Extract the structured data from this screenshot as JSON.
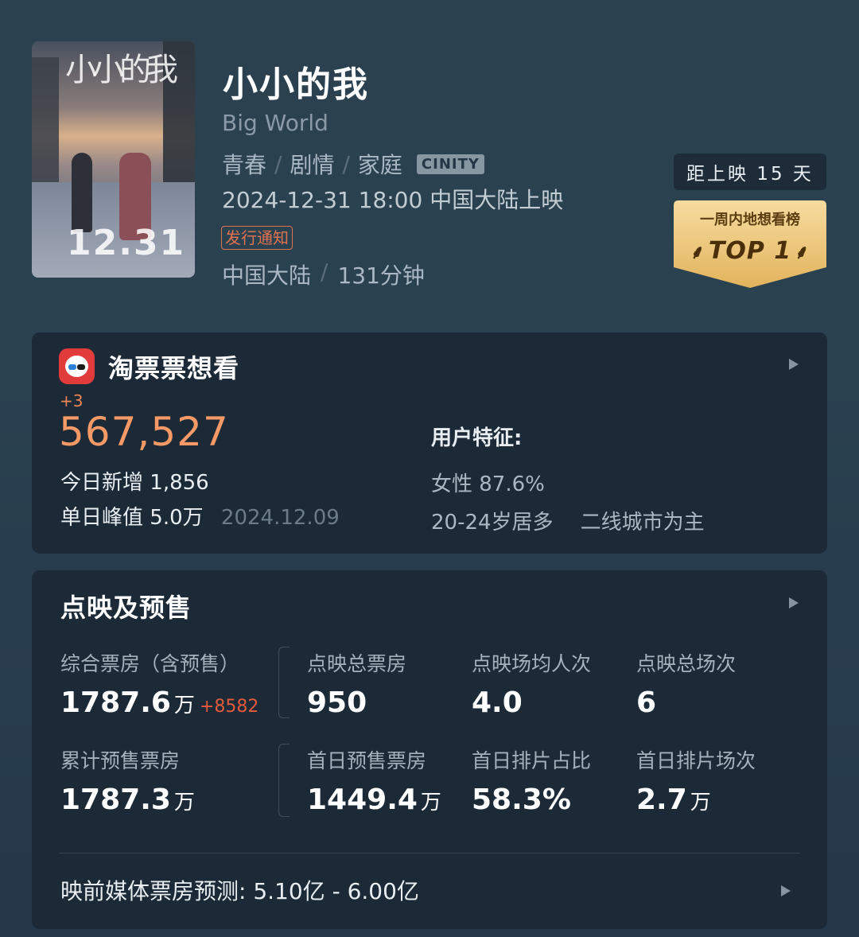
{
  "movie": {
    "title": "小小的我",
    "subtitle": "Big World",
    "genres": [
      "青春",
      "剧情",
      "家庭"
    ],
    "format_badge": "CINITY",
    "release": "2024-12-31 18:00 中国大陆上映",
    "notice_badge": "发行通知",
    "region": "中国大陆",
    "duration": "131分钟",
    "countdown": "距上映 15 天",
    "rank_badge": {
      "line1": "一周内地想看榜",
      "line2": "TOP 1"
    },
    "poster": {
      "title_art": "小小的我",
      "date": "12.31"
    }
  },
  "wishlist": {
    "title": "淘票票想看",
    "delta": "+3",
    "total": "567,527",
    "today_label": "今日新增",
    "today_value": "1,856",
    "peak_label": "单日峰值",
    "peak_value": "5.0万",
    "peak_date": "2024.12.09",
    "features_label": "用户特征:",
    "female": "女性 87.6%",
    "age": "20-24岁居多",
    "city": "二线城市为主"
  },
  "presale": {
    "title": "点映及预售",
    "stats": [
      {
        "label": "综合票房（含预售）",
        "value": "1787.6",
        "unit": "万",
        "plus": "+8582"
      },
      {
        "label": "点映总票房",
        "value": "950"
      },
      {
        "label": "点映场均人次",
        "value": "4.0"
      },
      {
        "label": "点映总场次",
        "value": "6"
      },
      {
        "label": "累计预售票房",
        "value": "1787.3",
        "unit": "万"
      },
      {
        "label": "首日预售票房",
        "value": "1449.4",
        "unit": "万"
      },
      {
        "label": "首日排片占比",
        "value": "58.3%"
      },
      {
        "label": "首日排片场次",
        "value": "2.7",
        "unit": "万"
      }
    ],
    "forecast": "映前媒体票房预测:  5.10亿 - 6.00亿"
  },
  "colors": {
    "accent_orange": "#f59a66",
    "red_plus": "#e55a3c",
    "badge_gold": "#e9c27a"
  }
}
